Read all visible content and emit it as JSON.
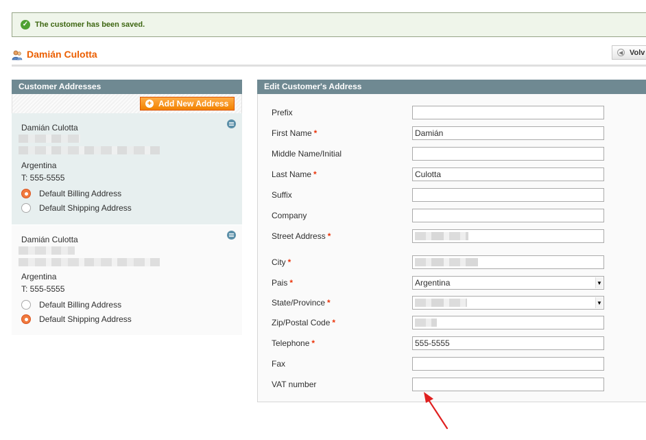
{
  "messages": {
    "success": "The customer has been saved."
  },
  "header": {
    "title": "Damián Culotta",
    "back_label": "Volv"
  },
  "addresses_panel": {
    "title": "Customer Addresses",
    "add_button": "Add New Address",
    "cards": [
      {
        "name": "Damián Culotta",
        "country": "Argentina",
        "phone": "T: 555-5555",
        "billing_label": "Default Billing Address",
        "shipping_label": "Default Shipping Address",
        "default_billing": true,
        "default_shipping": false
      },
      {
        "name": "Damián Culotta",
        "country": "Argentina",
        "phone": "T: 555-5555",
        "billing_label": "Default Billing Address",
        "shipping_label": "Default Shipping Address",
        "default_billing": false,
        "default_shipping": true
      }
    ]
  },
  "edit_panel": {
    "title": "Edit Customer's Address",
    "fields": {
      "prefix": {
        "label": "Prefix",
        "value": ""
      },
      "first_name": {
        "label": "First Name",
        "value": "Damián"
      },
      "middle_name": {
        "label": "Middle Name/Initial",
        "value": ""
      },
      "last_name": {
        "label": "Last Name",
        "value": "Culotta"
      },
      "suffix": {
        "label": "Suffix",
        "value": ""
      },
      "company": {
        "label": "Company",
        "value": ""
      },
      "street": {
        "label": "Street Address",
        "value": ""
      },
      "city": {
        "label": "City",
        "value": ""
      },
      "country": {
        "label": "Pais",
        "value": "Argentina"
      },
      "region": {
        "label": "State/Province",
        "value": ""
      },
      "postcode": {
        "label": "Zip/Postal Code",
        "value": ""
      },
      "telephone": {
        "label": "Telephone",
        "value": "555-5555"
      },
      "fax": {
        "label": "Fax",
        "value": ""
      },
      "vat": {
        "label": "VAT number",
        "value": ""
      }
    },
    "required_marker": "*"
  },
  "colors": {
    "accent": "#eb5e00",
    "panel_header": "#6f8992",
    "success_text": "#3d6611",
    "required": "#eb340a",
    "annotation_arrow": "#e02020"
  }
}
